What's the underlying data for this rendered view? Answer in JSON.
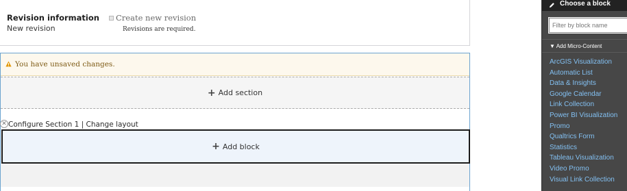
{
  "revision": {
    "title": "Revision information",
    "subtitle": "New revision",
    "create_label": "Create new revision",
    "help": "Revisions are required."
  },
  "layout_builder": {
    "warning": "You have unsaved changes.",
    "add_section": "Add section",
    "configure_section": "Configure Section 1",
    "separator": " | ",
    "change_layout": "Change layout",
    "add_block": "Add block",
    "remove_glyph": "✕"
  },
  "sidebar": {
    "title": "Choose a block",
    "filter_placeholder": "Filter by block name",
    "group_label": "▼ Add Micro-Content",
    "links": [
      "ArcGIS Visualization",
      "Automatic List",
      "Data & Insights",
      "Google Calendar",
      "Link Collection",
      "Power BI Visualization",
      "Promo",
      "Qualtrics Form",
      "Statistics",
      "Tableau Visualization",
      "Video Promo",
      "Visual Link Collection"
    ]
  },
  "icons": {
    "warning": "warning-icon",
    "pencil": "pencil-icon",
    "plus": "plus-icon",
    "close": "close-icon"
  },
  "colors": {
    "sidebar_bg": "#474747",
    "sidebar_header": "#222222",
    "link": "#83c0f2",
    "warning_bg": "#fdf8ed",
    "warning_text": "#7d5a14",
    "layout_border": "#6ba3cf"
  }
}
